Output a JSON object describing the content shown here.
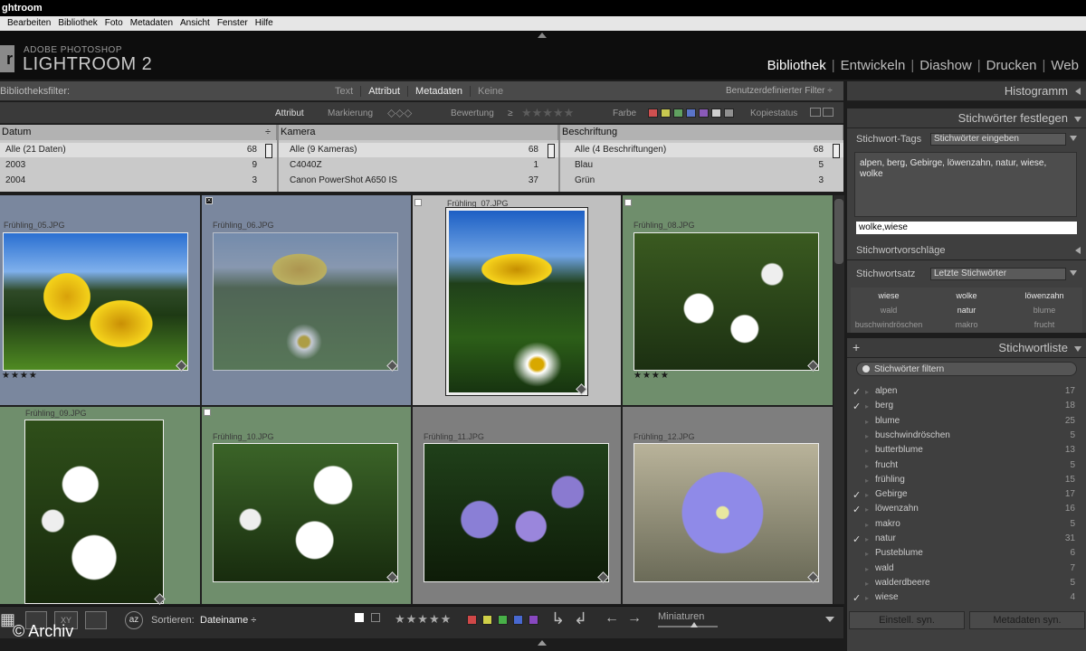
{
  "app": {
    "title": "ghtroom"
  },
  "menu": [
    "Bearbeiten",
    "Bibliothek",
    "Foto",
    "Metadaten",
    "Ansicht",
    "Fenster",
    "Hilfe"
  ],
  "brand": {
    "badge": "r",
    "line1": "ADOBE PHOTOSHOP",
    "line2": "LIGHTROOM 2"
  },
  "modules": [
    {
      "label": "Bibliothek",
      "active": true
    },
    {
      "label": "Entwickeln"
    },
    {
      "label": "Diashow"
    },
    {
      "label": "Drucken"
    },
    {
      "label": "Web"
    }
  ],
  "filter": {
    "label": "Bibliotheksfilter:",
    "tabs": [
      {
        "label": "Text"
      },
      {
        "label": "Attribut",
        "on": true
      },
      {
        "label": "Metadaten",
        "on": true
      },
      {
        "label": "Keine"
      }
    ],
    "custom": "Benutzerdefinierter Filter ÷"
  },
  "attrbar": {
    "attribut": "Attribut",
    "markierung": "Markierung",
    "bewertung": "Bewertung",
    "rating_op": "≥",
    "farbe": "Farbe",
    "kopiestatus": "Kopiestatus",
    "colors": [
      "#d05050",
      "#c8c850",
      "#60a060",
      "#5a74c8",
      "#8a5ab8",
      "#cfcfcf",
      "#909090"
    ]
  },
  "meta": {
    "columns": [
      {
        "title": "Datum",
        "rows": [
          {
            "label": "Alle (21 Daten)",
            "count": "68"
          },
          {
            "label": "2003",
            "count": "9"
          },
          {
            "label": "2004",
            "count": "3"
          }
        ]
      },
      {
        "title": "Kamera",
        "rows": [
          {
            "label": "Alle (9 Kameras)",
            "count": "68"
          },
          {
            "label": "C4040Z",
            "count": "1"
          },
          {
            "label": "Canon PowerShot A650 IS",
            "count": "37"
          }
        ]
      },
      {
        "title": "Beschriftung",
        "rows": [
          {
            "label": "Alle (4 Beschriftungen)",
            "count": "68"
          },
          {
            "label": "Blau",
            "count": "5"
          },
          {
            "label": "Grün",
            "count": "3"
          }
        ]
      }
    ]
  },
  "thumbs": [
    {
      "name": "Frühling_05.JPG",
      "stars": "★★★★"
    },
    {
      "name": "Frühling_06.JPG",
      "stars": ""
    },
    {
      "name": "Frühling_07.JPG",
      "stars": ""
    },
    {
      "name": "Frühling_08.JPG",
      "stars": "★★★★"
    },
    {
      "name": "Frühling_09.JPG",
      "stars": ""
    },
    {
      "name": "Frühling_10.JPG",
      "stars": ""
    },
    {
      "name": "Frühling_11.JPG",
      "stars": ""
    },
    {
      "name": "Frühling_12.JPG",
      "stars": ""
    }
  ],
  "toolbar": {
    "sortieren": "Sortieren:",
    "sortvalue": "Dateiname ÷",
    "miniaturen": "Miniaturen",
    "stars": "★★★★★",
    "colors": [
      "#d04848",
      "#d0d048",
      "#48b048",
      "#4868d0",
      "#8848c0"
    ]
  },
  "watermark": "© Archiv",
  "right": {
    "histogramm": "Histogramm",
    "stichwoerter": "Stichwörter festlegen",
    "tags_label": "Stichwort-Tags",
    "tags_drop": "Stichwörter eingeben",
    "tags_text": "alpen, berg, Gebirge, löwenzahn, natur, wiese, wolke",
    "input_value": "wolke,wiese",
    "vorschlaege": "Stichwortvorschläge",
    "satz_label": "Stichwortsatz",
    "satz_drop": "Letzte Stichwörter",
    "suggestions": [
      [
        "wiese",
        "wolke",
        "löwenzahn"
      ],
      [
        "wald",
        "natur",
        "blume"
      ],
      [
        "buschwindröschen",
        "makro",
        "frucht"
      ]
    ],
    "liste": "Stichwortliste",
    "plus": "+",
    "filter_ph": "Stichwörter filtern",
    "keywords": [
      {
        "label": "alpen",
        "count": "17",
        "checked": true
      },
      {
        "label": "berg",
        "count": "18",
        "checked": true
      },
      {
        "label": "blume",
        "count": "25"
      },
      {
        "label": "buschwindröschen",
        "count": "5"
      },
      {
        "label": "butterblume",
        "count": "13"
      },
      {
        "label": "frucht",
        "count": "5"
      },
      {
        "label": "frühling",
        "count": "15"
      },
      {
        "label": "Gebirge",
        "count": "17",
        "checked": true
      },
      {
        "label": "löwenzahn",
        "count": "16",
        "checked": true
      },
      {
        "label": "makro",
        "count": "5"
      },
      {
        "label": "natur",
        "count": "31",
        "checked": true
      },
      {
        "label": "Pusteblume",
        "count": "6"
      },
      {
        "label": "wald",
        "count": "7"
      },
      {
        "label": "walderdbeere",
        "count": "5"
      },
      {
        "label": "wiese",
        "count": "4",
        "checked": true
      }
    ],
    "btn_sync1": "Einstell. syn.",
    "btn_sync2": "Metadaten syn."
  }
}
